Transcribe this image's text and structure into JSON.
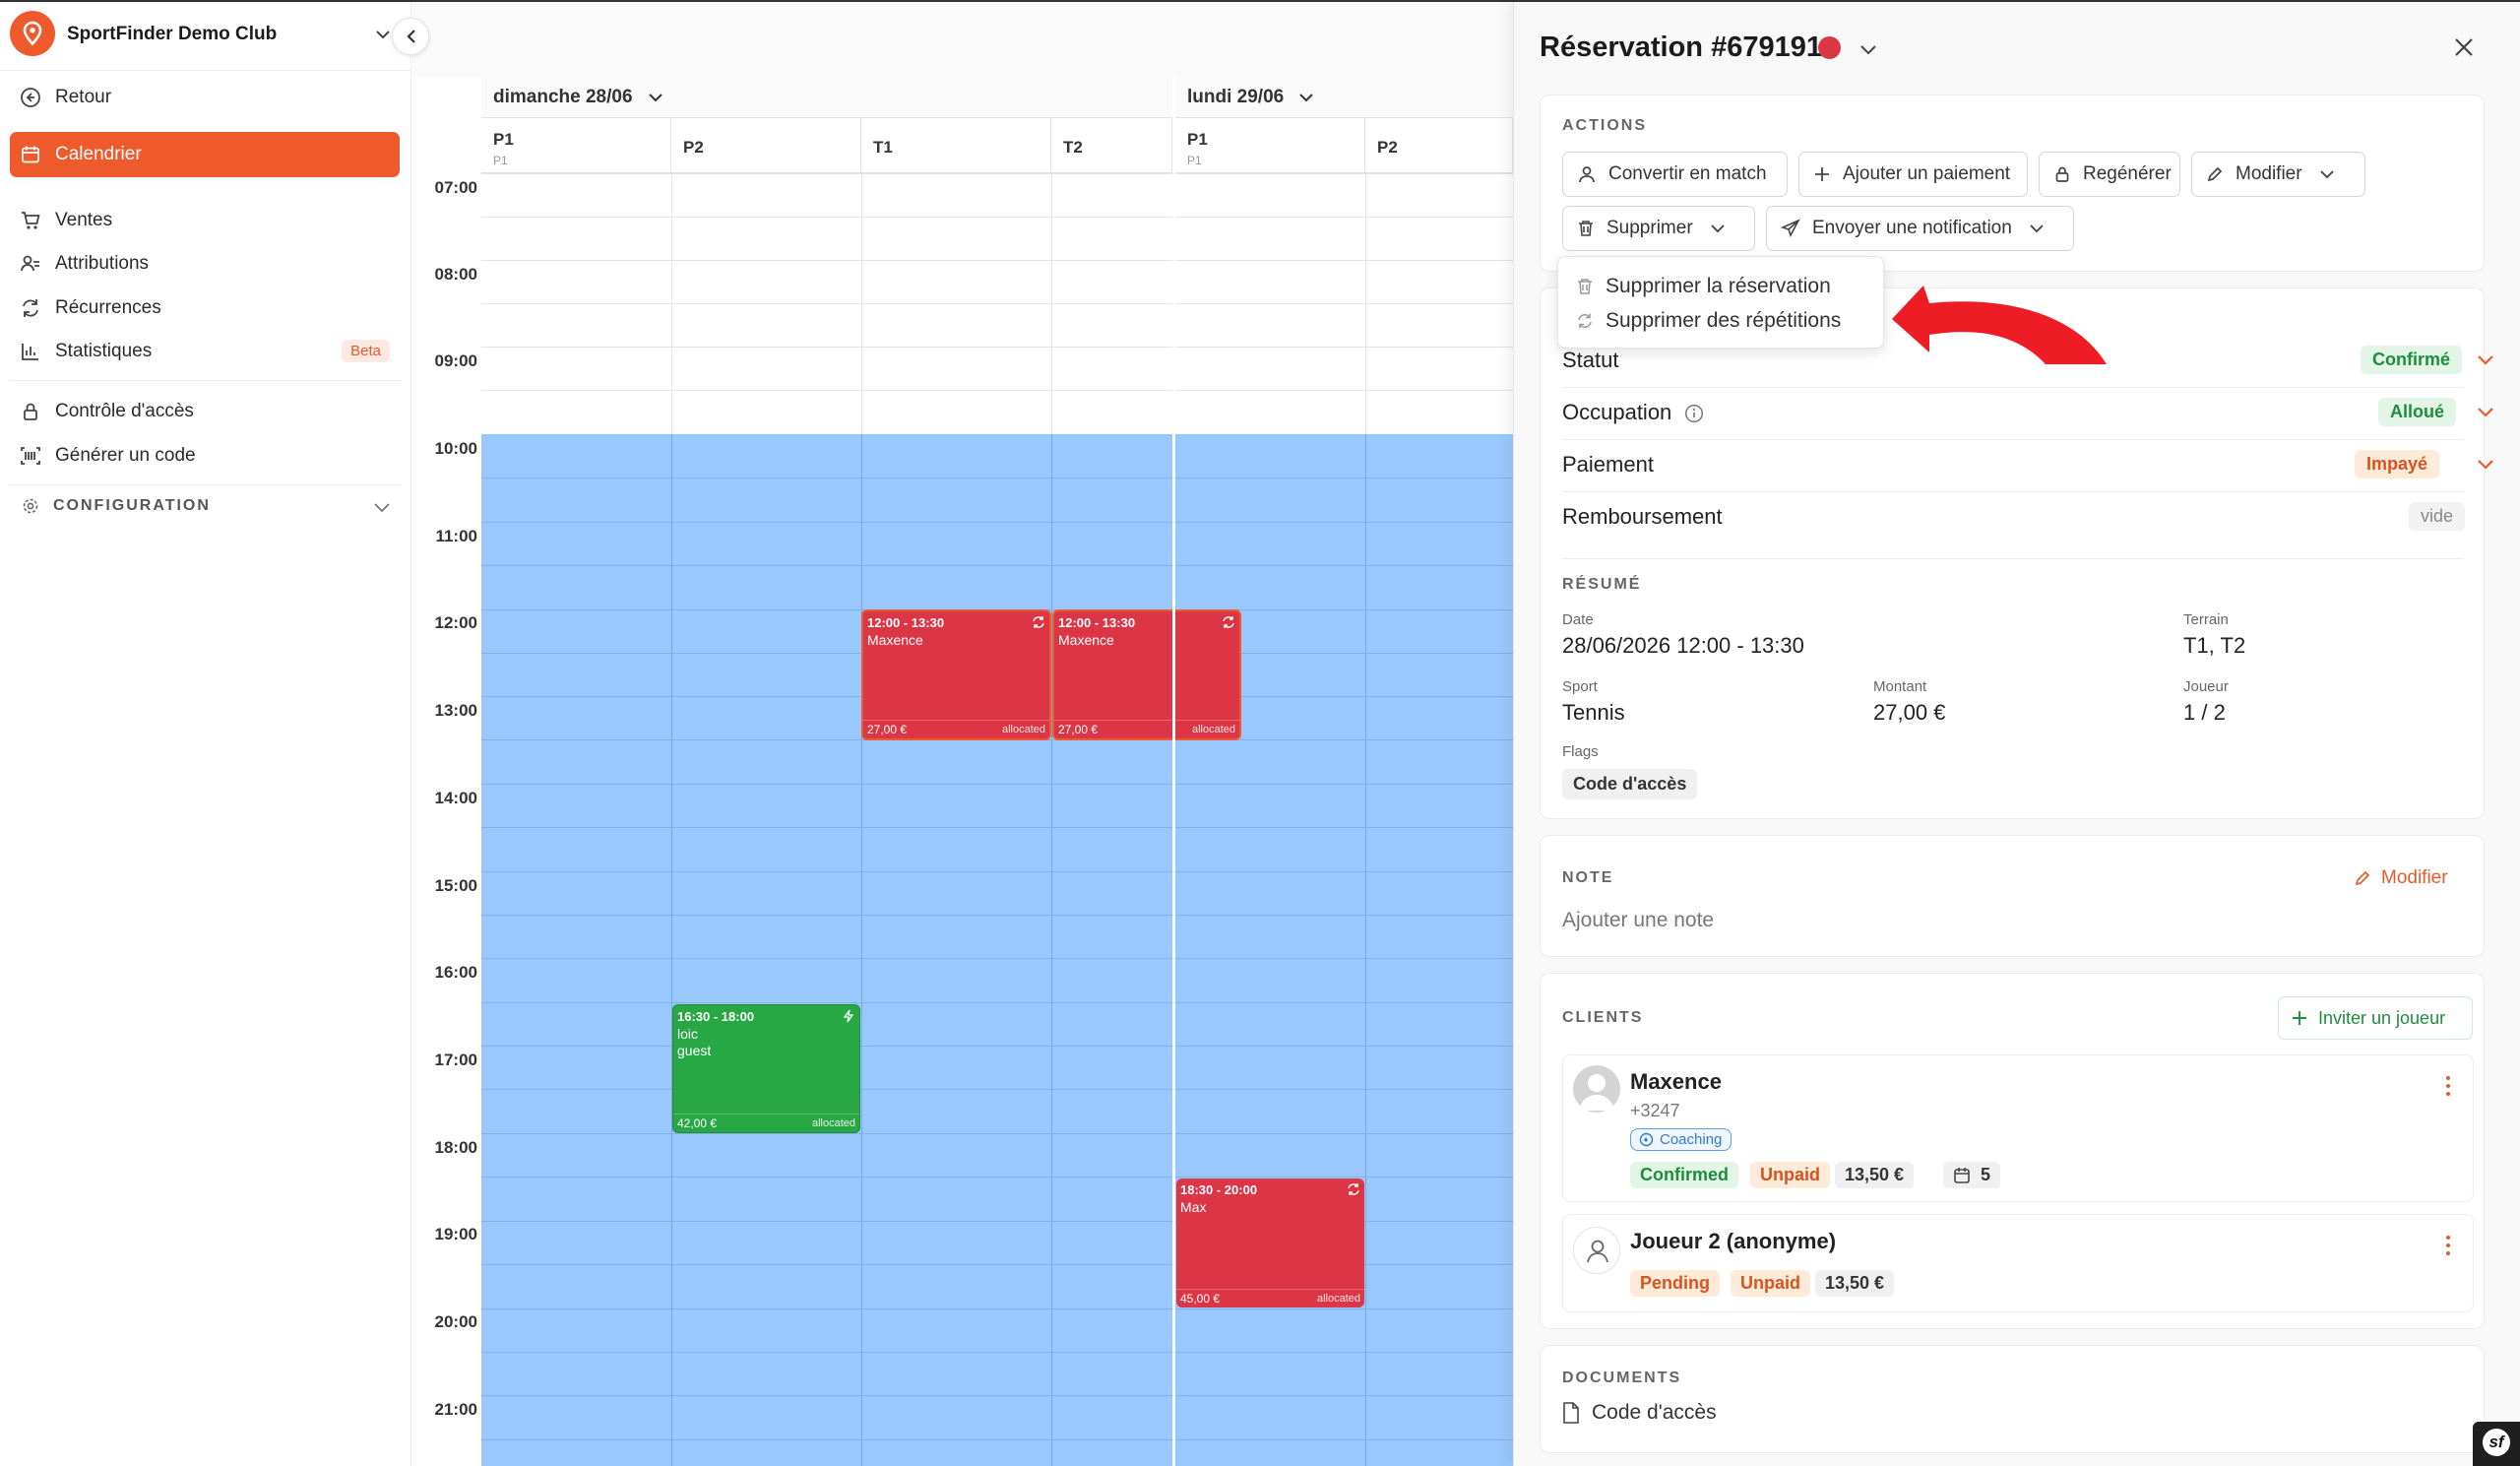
{
  "sidebar": {
    "club_name": "SportFinder Demo Club",
    "back_label": "Retour",
    "items": [
      {
        "label": "Calendrier",
        "icon": "calendar-icon",
        "active": true
      },
      {
        "label": "Ventes",
        "icon": "cart-icon"
      },
      {
        "label": "Attributions",
        "icon": "user-list-icon"
      },
      {
        "label": "Récurrences",
        "icon": "refresh-icon"
      },
      {
        "label": "Statistiques",
        "icon": "bar-chart-icon",
        "badge": "Beta"
      },
      {
        "label": "Contrôle d'accès",
        "icon": "lock-icon"
      },
      {
        "label": "Générer un code",
        "icon": "barcode-icon"
      }
    ],
    "config_label": "CONFIGURATION"
  },
  "calendar": {
    "days": [
      {
        "label": "dimanche 28/06",
        "columns": [
          {
            "name": "P1",
            "sub": "P1"
          },
          {
            "name": "P2"
          },
          {
            "name": "T1"
          },
          {
            "name": "T2"
          }
        ]
      },
      {
        "label": "lundi 29/06",
        "columns": [
          {
            "name": "P1",
            "sub": "P1"
          },
          {
            "name": "P2"
          }
        ]
      }
    ],
    "hours": [
      "07:00",
      "08:00",
      "09:00",
      "10:00",
      "11:00",
      "12:00",
      "13:00",
      "14:00",
      "15:00",
      "16:00",
      "17:00",
      "18:00",
      "19:00",
      "20:00",
      "21:00"
    ],
    "events": [
      {
        "time": "12:00 - 13:30",
        "name": "Maxence",
        "price": "27,00 €",
        "status": "allocated",
        "color": "#dc3545"
      },
      {
        "time": "12:00 - 13:30",
        "name": "Maxence",
        "price": "27,00 €",
        "status": "allocated",
        "color": "#dc3545"
      },
      {
        "time": "16:30 - 18:00",
        "name": "loic",
        "name2": "guest",
        "price": "42,00 €",
        "status": "allocated",
        "color": "#28a745"
      },
      {
        "time": "18:30 - 20:00",
        "name": "Max",
        "price": "45,00 €",
        "status": "allocated",
        "color": "#dc3545"
      }
    ]
  },
  "panel": {
    "title": "Réservation #679191",
    "status_color": "#dc3545",
    "actions_label": "ACTIONS",
    "buttons": {
      "convert": "Convertir en match",
      "add_payment": "Ajouter un paiement",
      "regenerate": "Regénérer",
      "modify": "Modifier",
      "delete": "Supprimer",
      "notify": "Envoyer une notification"
    },
    "delete_menu": [
      "Supprimer la réservation",
      "Supprimer des répétitions"
    ],
    "rows": [
      {
        "label": "Statut",
        "value": "Confirmé"
      },
      {
        "label": "Occupation",
        "value": "Alloué"
      },
      {
        "label": "Paiement",
        "value": "Impayé"
      },
      {
        "label": "Remboursement",
        "value": "vide"
      }
    ],
    "summary": {
      "label": "RÉSUMÉ",
      "date_label": "Date",
      "date": "28/06/2026 12:00 - 13:30",
      "terrain_label": "Terrain",
      "terrain": "T1, T2",
      "sport_label": "Sport",
      "sport": "Tennis",
      "amount_label": "Montant",
      "amount": "27,00 €",
      "players_label": "Joueur",
      "players": "1 / 2",
      "flags_label": "Flags",
      "flag": "Code d'accès"
    },
    "note": {
      "label": "NOTE",
      "edit": "Modifier",
      "placeholder": "Ajouter une note"
    },
    "clients": {
      "label": "CLIENTS",
      "invite": "Inviter un joueur",
      "list": [
        {
          "name": "Maxence",
          "phone": "+3247",
          "tag": "Coaching",
          "status": "Confirmed",
          "payment": "Unpaid",
          "amount": "13,50 €",
          "count": "5"
        },
        {
          "name": "Joueur 2 (anonyme)",
          "status": "Pending",
          "payment": "Unpaid",
          "amount": "13,50 €"
        }
      ]
    },
    "documents": {
      "label": "DOCUMENTS",
      "item": "Code d'accès"
    }
  }
}
